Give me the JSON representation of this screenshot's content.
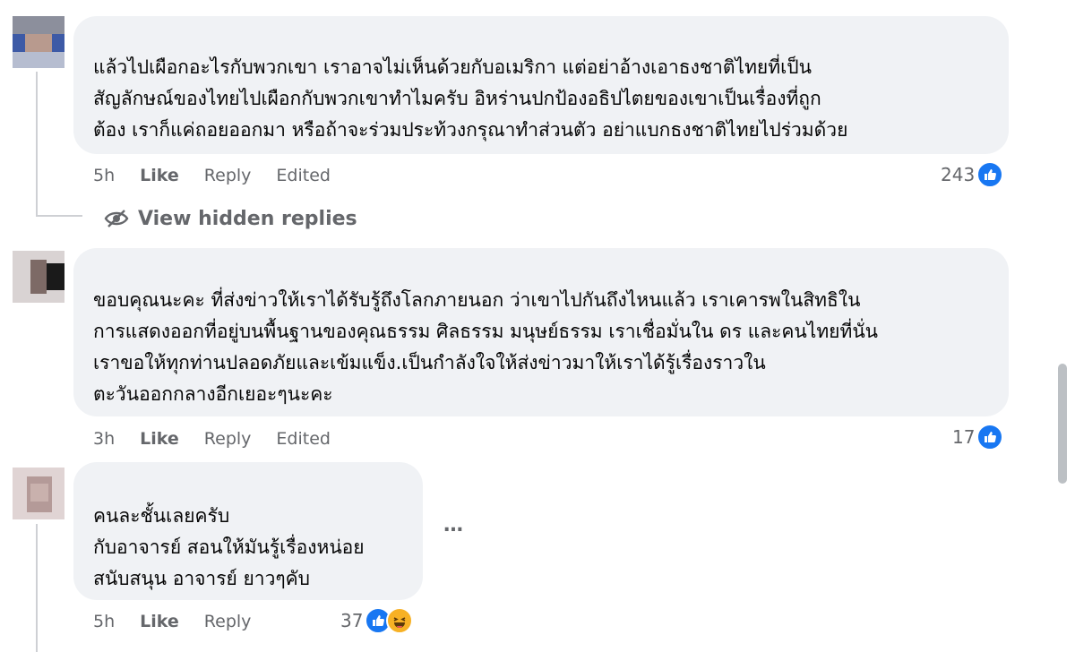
{
  "colors": {
    "bubble": "#f0f2f5",
    "like_blue": "#1877f2",
    "meta_text": "#65676b",
    "haha_yellow": "#f7b125"
  },
  "comments": [
    {
      "lines": [
        "แล้วไปเผือกอะไรกับพวกเขา เราอาจไม่เห็นด้วยกับอเมริกา แต่อย่าอ้างเอาธงชาติไทยที่เป็น",
        "สัญลักษณ์ของไทยไปเผือกกับพวกเขาทำไมครับ อิหร่านปกป้องอธิปไตยของเขาเป็นเรื่องที่ถูก",
        "ต้อง เราก็แค่ถอยออกมา หรือถ้าจะร่วมประท้วงกรุณาทำส่วนตัว อย่าแบกธงชาติไทยไปร่วมด้วย"
      ],
      "time": "5h",
      "like": "Like",
      "reply": "Reply",
      "edited": "Edited",
      "reactions": "243",
      "reaction_icons": [
        "like-icon"
      ]
    },
    {
      "lines": [
        "ขอบคุณนะคะ ที่ส่งข่าวให้เราได้รับรู้ถึงโลกภายนอก ว่าเขาไปกันถึงไหนแล้ว เราเคารพในสิทธิใน",
        "การแสดงออกที่อยู่บนพื้นฐานของคุณธรรม ศิลธรรม มนุษย์ธรรม เราเชื่อมั่นใน ดร และคนไทยที่นั่น",
        "เราขอให้ทุกท่านปลอดภัยและเข้มแข็ง.เป็นกำลังใจให้ส่งข่าวมาให้เราได้รู้เรื่องราวใน",
        "ตะวันออกกลางอีกเยอะๆนะคะ"
      ],
      "time": "3h",
      "like": "Like",
      "reply": "Reply",
      "edited": "Edited",
      "reactions": "17",
      "reaction_icons": [
        "like-icon"
      ]
    },
    {
      "lines": [
        "คนละชั้นเลยครับ",
        "กับอาจารย์ สอนให้มันรู้เรื่องหน่อย",
        "สนับสนุน อาจารย์ ยาวๆคับ"
      ],
      "time": "5h",
      "like": "Like",
      "reply": "Reply",
      "reactions": "37",
      "reaction_icons": [
        "like-icon",
        "haha-icon"
      ],
      "more": "…"
    }
  ],
  "hidden_replies": "View hidden replies"
}
